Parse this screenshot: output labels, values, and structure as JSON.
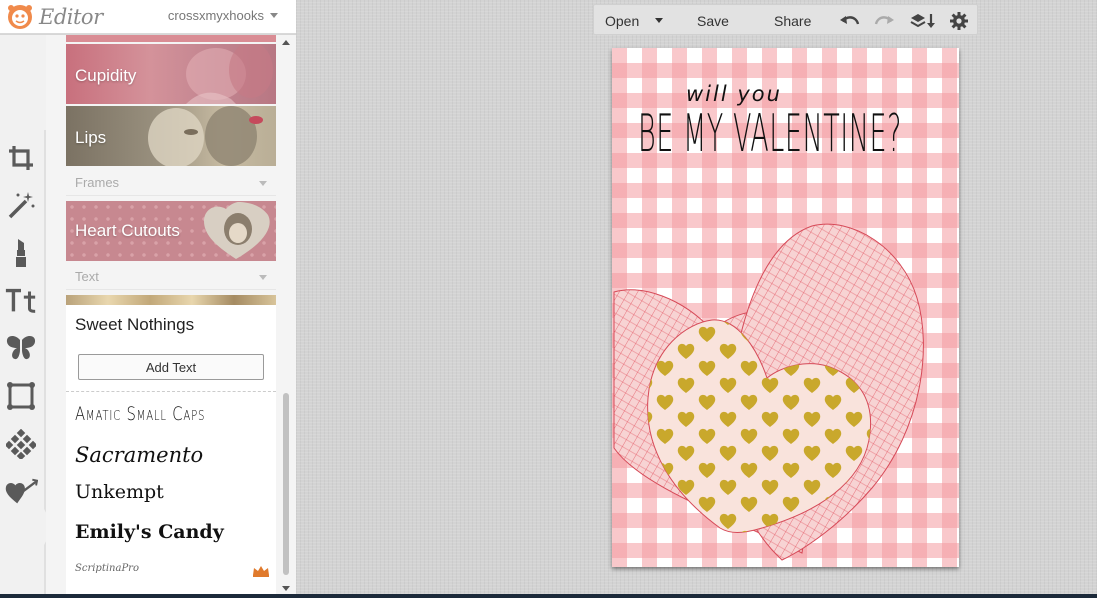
{
  "header": {
    "app_title": "Editor",
    "username": "crossxmyxhooks"
  },
  "tools": [
    {
      "icon": "crop-icon"
    },
    {
      "icon": "magic-wand-icon"
    },
    {
      "icon": "lipstick-icon"
    },
    {
      "icon": "text-tool-icon",
      "label": "Tt"
    },
    {
      "icon": "butterfly-icon"
    },
    {
      "icon": "frame-icon"
    },
    {
      "icon": "texture-icon"
    },
    {
      "icon": "heart-arrow-icon"
    }
  ],
  "panel": {
    "tiles": [
      {
        "label": "Cupidity"
      },
      {
        "label": "Lips"
      }
    ],
    "frames_section": {
      "label": "Frames"
    },
    "frame_tile": {
      "label": "Heart Cutouts"
    },
    "text_section": {
      "label": "Text"
    },
    "text_card": {
      "title": "Sweet Nothings",
      "add_button": "Add Text",
      "fonts": [
        "Amatic Small Caps",
        "Sacramento",
        "Unkempt",
        "Emily's Candy",
        "ScriptinaPro"
      ]
    }
  },
  "toolbar": {
    "open_label": "Open",
    "save_label": "Save",
    "share_label": "Share"
  },
  "canvas": {
    "line1": "will you",
    "line2": "BE MY VALENTINE?"
  },
  "colors": {
    "gingham": "#f49ba0",
    "heart_scribble": "#e25a66",
    "heart_inner": "#f9e3dc",
    "mini_heart": "#c9a82c",
    "crown": "#e07a2c"
  }
}
